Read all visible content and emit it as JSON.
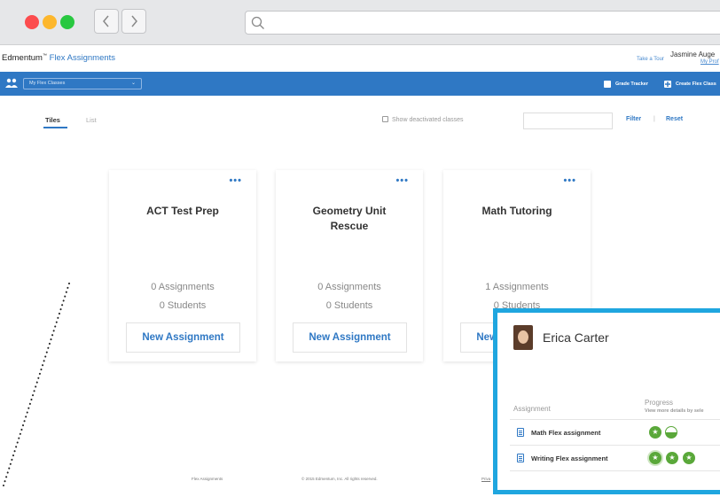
{
  "brand": {
    "name": "Edmentum",
    "trademark": "™",
    "product": "Flex Assignments"
  },
  "header": {
    "take_tour": "Take a Tour",
    "user_name": "Jasmine Auge",
    "my_profile": "My Prof"
  },
  "toolbar": {
    "class_select": "My Flex Classes",
    "grade_tracker": "Grade Tracker",
    "create_flex_class": "Create Flex Class"
  },
  "view": {
    "tabs": [
      "Tiles",
      "List"
    ],
    "show_deactivated": "Show deactivated classes",
    "filter_value": "",
    "filter_label": "Filter",
    "separator": "|",
    "reset_label": "Reset"
  },
  "cards": [
    {
      "title": "ACT Test Prep",
      "assignments": "0 Assignments",
      "students": "0 Students",
      "button": "New Assignment"
    },
    {
      "title": "Geometry Unit Rescue",
      "assignments": "0 Assignments",
      "students": "0 Students",
      "button": "New Assignment"
    },
    {
      "title": "Math Tutoring",
      "assignments": "1 Assignments",
      "students": "0 Students",
      "button": "New Assignment"
    }
  ],
  "card_menu": "•••",
  "footer": {
    "left": "Flex Assignments",
    "center": "© 2015 Edmentum, Inc. All rights reserved.",
    "right": "Priva"
  },
  "student_panel": {
    "name": "Erica Carter",
    "col_assignment": "Assignment",
    "col_progress": "Progress",
    "col_progress_sub": "View more details by sele",
    "rows": [
      {
        "label": "Math Flex assignment",
        "progress": [
          "star",
          "half"
        ]
      },
      {
        "label": "Writing Flex assignment",
        "progress": [
          "star",
          "star",
          "star"
        ]
      }
    ]
  },
  "colors": {
    "accent": "#2f78c4",
    "panel_border": "#1fa6df",
    "progress": "#5aa83a"
  }
}
